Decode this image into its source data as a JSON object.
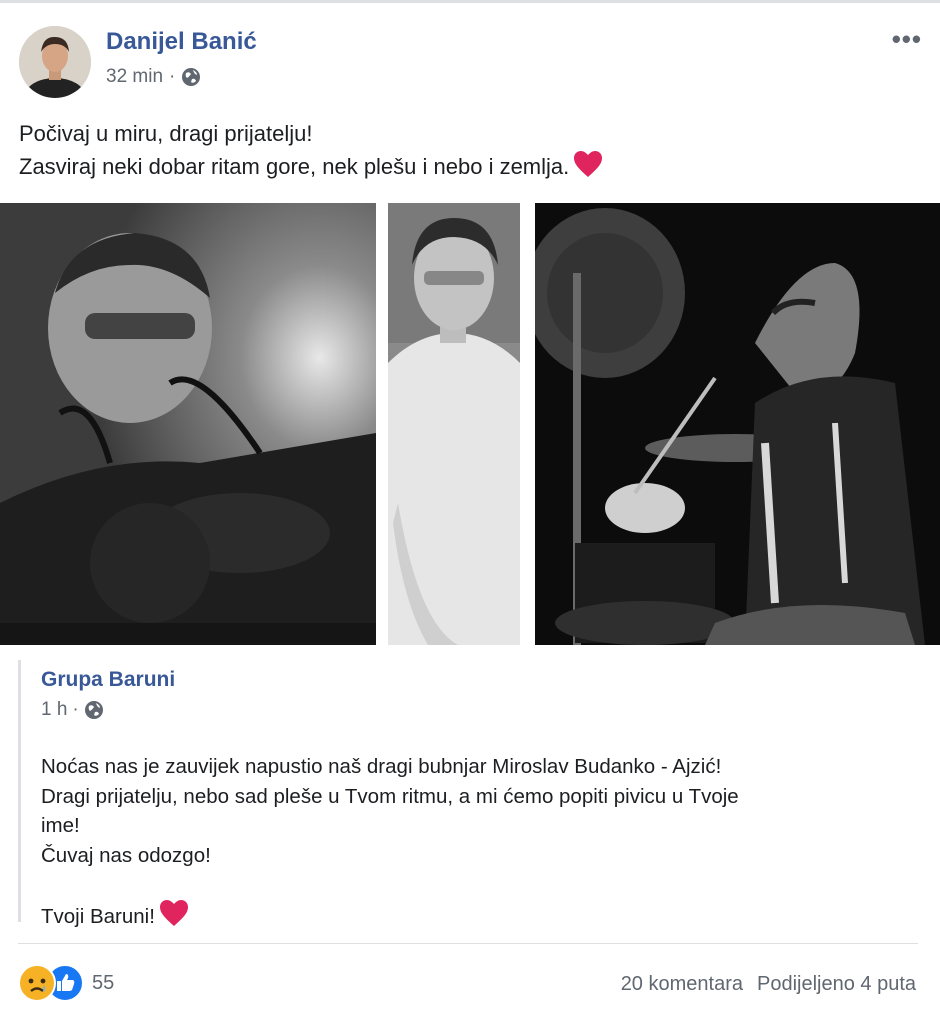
{
  "post": {
    "author": "Danijel Banić",
    "time": "32 min",
    "meta_sep": "·",
    "privacy_icon": "globe-icon",
    "more_label": "•••",
    "text_lines": [
      "Počivaj u miru, dragi prijatelju!",
      "Zasviraj neki dobar ritam gore, nek plešu i nebo i zemlja."
    ]
  },
  "shared": {
    "author": "Grupa Baruni",
    "time": "1 h",
    "meta_sep": "·",
    "text_lines": [
      "Noćas nas je zauvijek napustio naš dragi bubnjar Miroslav Budanko - Ajzić!",
      "Dragi prijatelju, nebo sad pleše u Tvom ritmu, a mi ćemo popiti pivicu u Tvoje",
      "ime!",
      "Čuvaj nas odozgo!"
    ],
    "signoff": "Tvoji Baruni!"
  },
  "footer": {
    "reaction_count": "55",
    "comments": "20 komentara",
    "shares": "Podijeljeno 4 puta"
  },
  "colors": {
    "link": "#385898",
    "heart": "#e0245e",
    "like": "#1877f2",
    "sad": "#f7b125"
  }
}
